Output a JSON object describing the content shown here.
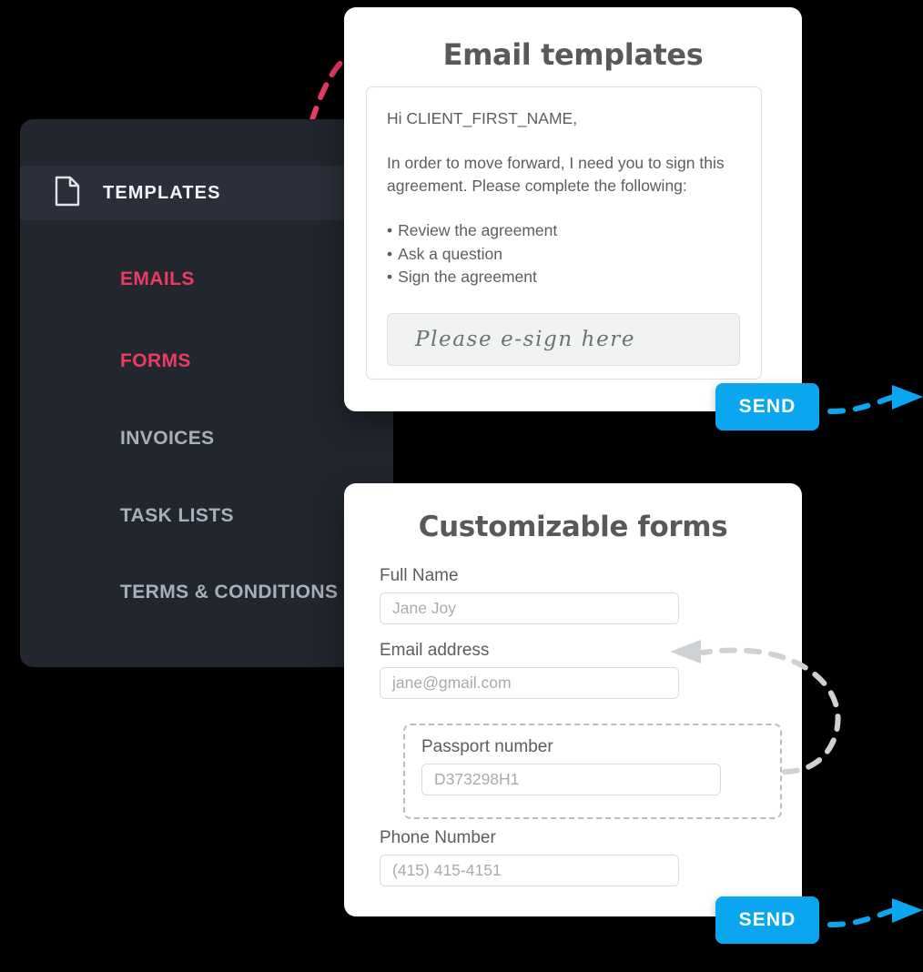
{
  "colors": {
    "background": "#000000",
    "sidebar_bg": "#22262f",
    "sidebar_active_bg": "#2a2f39",
    "sidebar_text": "#a9afb8",
    "accent_pink": "#ec3b63",
    "accent_blue": "#0aa6ef",
    "card_bg": "#ffffff",
    "card_title": "#58595b",
    "body_text": "#5b5d61",
    "placeholder": "#a7abb0",
    "dashed_grey": "#b9bdc2"
  },
  "sidebar": {
    "active_item": {
      "label": "TEMPLATES",
      "icon": "document-icon"
    },
    "items": [
      {
        "label": "EMAILS",
        "state": "highlight"
      },
      {
        "label": "FORMS",
        "state": "highlight"
      },
      {
        "label": "INVOICES",
        "state": "normal"
      },
      {
        "label": "TASK LISTS",
        "state": "normal"
      },
      {
        "label": "TERMS & CONDITIONS",
        "state": "normal"
      }
    ]
  },
  "email_card": {
    "title": "Email templates",
    "greeting": "Hi CLIENT_FIRST_NAME,",
    "body": "In order to move forward, I need you to sign this agreement. Please complete the following:",
    "checklist": [
      "Review the agreement",
      "Ask a question",
      "Sign the agreement"
    ],
    "signature_placeholder": "Please e-sign here",
    "send_label": "SEND"
  },
  "forms_card": {
    "title": "Customizable forms",
    "fields": [
      {
        "label": "Full Name",
        "placeholder": "Jane Joy"
      },
      {
        "label": "Email address",
        "placeholder": "jane@gmail.com"
      },
      {
        "label": "Phone Number",
        "placeholder": "(415) 415-4151"
      }
    ],
    "highlighted_field": {
      "label": "Passport number",
      "placeholder": "D373298H1"
    },
    "send_label": "SEND"
  }
}
